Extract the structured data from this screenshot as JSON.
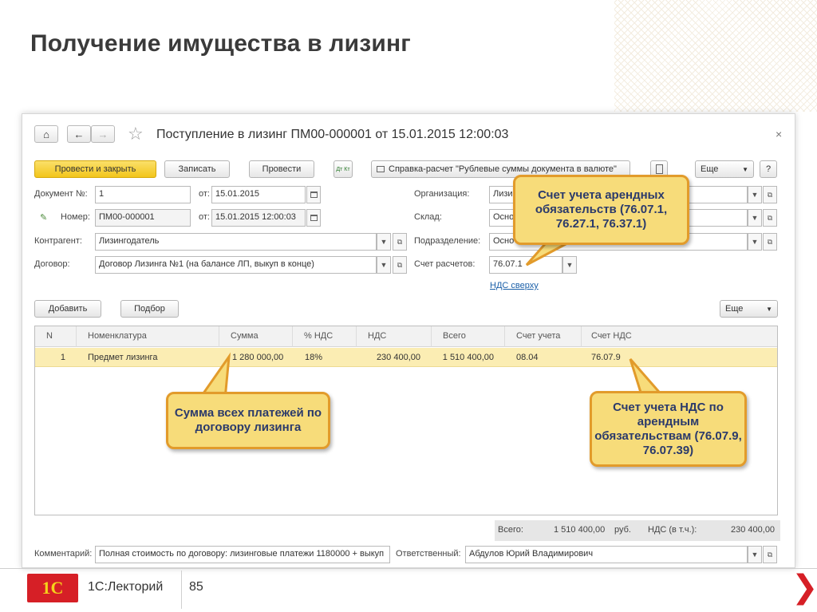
{
  "slide": {
    "title": "Получение имущества в лизинг"
  },
  "window": {
    "title": "Поступление в лизинг ПМ00-000001 от 15.01.2015 12:00:03",
    "nav": {
      "home": "⌂",
      "back": "←",
      "forward": "→"
    },
    "close": "×"
  },
  "toolbar": {
    "post_close": "Провести и закрыть",
    "save": "Записать",
    "post": "Провести",
    "dt_kt": "Дт Кт",
    "report": "Справка-расчет \"Рублевые суммы документа в валюте\"",
    "more": "Еще",
    "help": "?"
  },
  "form": {
    "doc_no_label": "Документ №:",
    "doc_no": "1",
    "from_label": "от:",
    "doc_date": "15.01.2015",
    "num_label": "Номер:",
    "number": "ПМ00-000001",
    "number_date": "15.01.2015 12:00:03",
    "counterparty_label": "Контрагент:",
    "counterparty": "Лизингодатель",
    "contract_label": "Договор:",
    "contract": "Договор Лизинга №1 (на балансе ЛП, выкуп в конце)",
    "org_label": "Организация:",
    "org": "Лизи",
    "warehouse_label": "Склад:",
    "warehouse": "Осно",
    "dept_label": "Подразделение:",
    "dept": "Осно",
    "account_label": "Счет расчетов:",
    "account": "76.07.1",
    "vat_link": "НДС сверху"
  },
  "table_toolbar": {
    "add": "Добавить",
    "select": "Подбор",
    "more": "Еще"
  },
  "table": {
    "columns": [
      "N",
      "Номенклатура",
      "Сумма",
      "% НДС",
      "НДС",
      "Всего",
      "Счет учета",
      "Счет НДС"
    ],
    "rows": [
      [
        "1",
        "Предмет лизинга",
        "1 280 000,00",
        "18%",
        "230 400,00",
        "1 510 400,00",
        "08.04",
        "76.07.9"
      ]
    ]
  },
  "totals": {
    "total_label": "Всего:",
    "total": "1 510 400,00",
    "currency": "руб.",
    "vat_label": "НДС (в т.ч.):",
    "vat": "230 400,00"
  },
  "footer_form": {
    "comment_label": "Комментарий:",
    "comment": "Полная стоимость по договору: лизинговые платежи 1180000 + выкуп",
    "responsible_label": "Ответственный:",
    "responsible": "Абдулов Юрий Владимирович"
  },
  "callouts": {
    "lease": "Счет учета арендных обязательств (76.07.1, 76.27.1, 76.37.1)",
    "sum": "Сумма всех платежей по договору лизинга",
    "vat": "Счет учета НДС по арендным обязательствам (76.07.9, 76.07.39)"
  },
  "footer": {
    "logo": "1С",
    "name": "1С:Лекторий",
    "page": "85"
  },
  "colors": {
    "accent_red": "#d61f26",
    "callout_fill": "#f7dc7a",
    "callout_border": "#e29b2b",
    "selected_row": "#fbedb3",
    "primary_button": "#f2c51b"
  }
}
